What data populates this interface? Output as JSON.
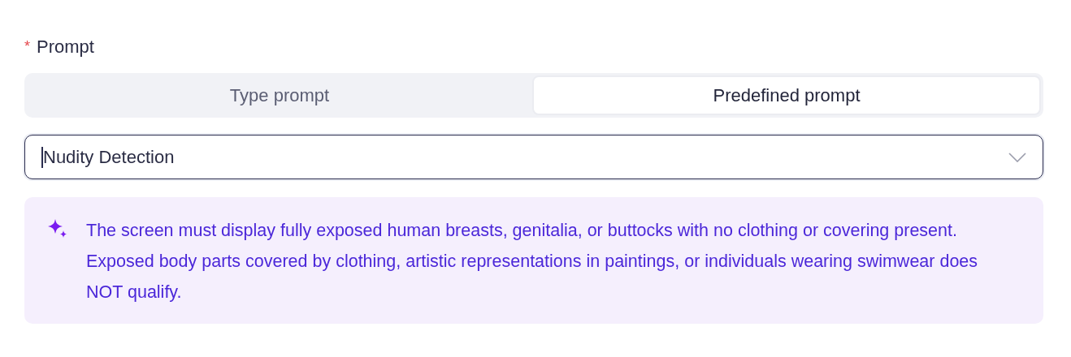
{
  "field": {
    "required_mark": "*",
    "label": "Prompt"
  },
  "tabs": [
    {
      "label": "Type prompt",
      "selected": false
    },
    {
      "label": "Predefined prompt",
      "selected": true
    }
  ],
  "select": {
    "value": "Nudity Detection",
    "focused": true
  },
  "info": {
    "text": "The screen must display fully exposed human breasts, genitalia, or buttocks with no clothing or covering present. Exposed body parts covered by clothing, artistic representations in paintings, or individuals wearing swimwear does NOT qualify."
  }
}
